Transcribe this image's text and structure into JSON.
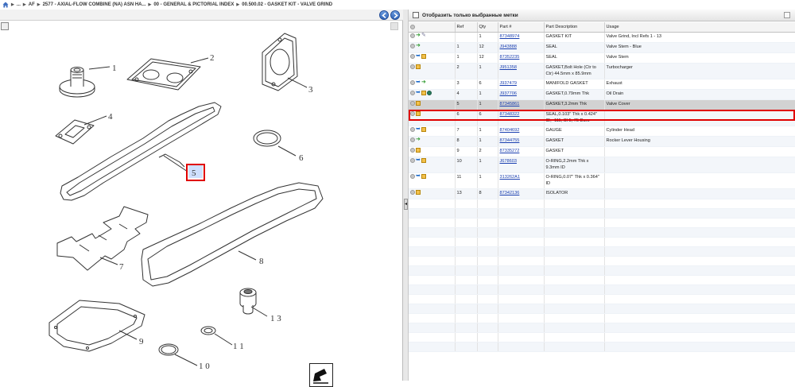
{
  "breadcrumb": {
    "items": [
      "...",
      "AF",
      "2577 - AXIAL-FLOW COMBINE (NA) ASN HA...",
      "00 - GENERAL & PICTORIAL INDEX",
      "00.500.02 - GASKET KIT - VALVE GRIND"
    ]
  },
  "viewer": {
    "callouts": [
      "1",
      "2",
      "3",
      "4",
      "5",
      "6",
      "7",
      "8",
      "9",
      "1 0",
      "1 1",
      "1 3"
    ]
  },
  "panel": {
    "filter_label": "Отобразить только выбранные метки",
    "columns": [
      "Ref",
      "Qty",
      "Part #",
      "Part Description",
      "Usage"
    ],
    "rows": [
      {
        "icons": [
          "circle-icon",
          "arrow-icon",
          "wrench-icon"
        ],
        "ref": "",
        "qty": "1",
        "part": "87348974",
        "desc": "GASKET KIT",
        "usage": "Valve Grind, Incl Refs 1 - 13"
      },
      {
        "icons": [
          "circle-icon",
          "arrow-icon"
        ],
        "ref": "1",
        "qty": "12",
        "part": "J943888",
        "desc": "SEAL",
        "usage": "Valve Stem - Blue"
      },
      {
        "icons": [
          "circle-icon",
          "blue-arrow-icon",
          "box-icon"
        ],
        "ref": "1",
        "qty": "12",
        "part": "87352235",
        "desc": "SEAL",
        "usage": "Valve Stem"
      },
      {
        "icons": [
          "circle-icon",
          "box-icon"
        ],
        "ref": "2",
        "qty": "1",
        "part": "J951358",
        "desc": "GASKET,Bolt Hole (Ctr to Ctr) 44.5mm x 85.9mm",
        "usage": "Turbocharger"
      },
      {
        "icons": [
          "circle-icon",
          "blue-arrow-icon",
          "arrow-icon"
        ],
        "ref": "3",
        "qty": "6",
        "part": "J937479",
        "desc": "MANIFOLD GASKET",
        "usage": "Exhaust"
      },
      {
        "icons": [
          "circle-icon",
          "blue-arrow-icon",
          "box-icon",
          "globe-icon"
        ],
        "ref": "4",
        "qty": "1",
        "part": "J937706",
        "desc": "GASKET,0.79mm Thk",
        "usage": "Oil Drain"
      },
      {
        "icons": [
          "circle-icon",
          "box-icon"
        ],
        "ref": "5",
        "qty": "1",
        "part": "87345861",
        "desc": "GASKET,3.2mm Thk",
        "usage": "Valve Cover"
      },
      {
        "icons": [
          "circle-icon",
          "box-icon"
        ],
        "ref": "6",
        "qty": "6",
        "part": "87348322",
        "desc": "SEAL,0.103\" Thk x 0.424\" ID, -111, Cl 5, 75 Duro",
        "usage": ""
      },
      {
        "icons": [
          "circle-icon",
          "blue-arrow-icon",
          "box-icon"
        ],
        "ref": "7",
        "qty": "1",
        "part": "87404692",
        "desc": "GAUGE",
        "usage": "Cylinder Head"
      },
      {
        "icons": [
          "circle-icon",
          "arrow-icon"
        ],
        "ref": "8",
        "qty": "1",
        "part": "87344755",
        "desc": "GASKET",
        "usage": "Rocker Lever Housing"
      },
      {
        "icons": [
          "circle-icon",
          "box-icon"
        ],
        "ref": "9",
        "qty": "2",
        "part": "87335272",
        "desc": "GASKET",
        "usage": ""
      },
      {
        "icons": [
          "circle-icon",
          "blue-arrow-icon",
          "box-icon"
        ],
        "ref": "10",
        "qty": "1",
        "part": "J678603",
        "desc": "O-RING,2.2mm Thk x 9.3mm ID",
        "usage": ""
      },
      {
        "icons": [
          "circle-icon",
          "blue-arrow-icon",
          "box-icon"
        ],
        "ref": "11",
        "qty": "1",
        "part": "313262A1",
        "desc": "O-RING,0.07\" Thk x 0.364\" ID",
        "usage": ""
      },
      {
        "icons": [
          "circle-icon",
          "box-icon"
        ],
        "ref": "13",
        "qty": "8",
        "part": "87342136",
        "desc": "ISOLATOR",
        "usage": ""
      }
    ]
  }
}
